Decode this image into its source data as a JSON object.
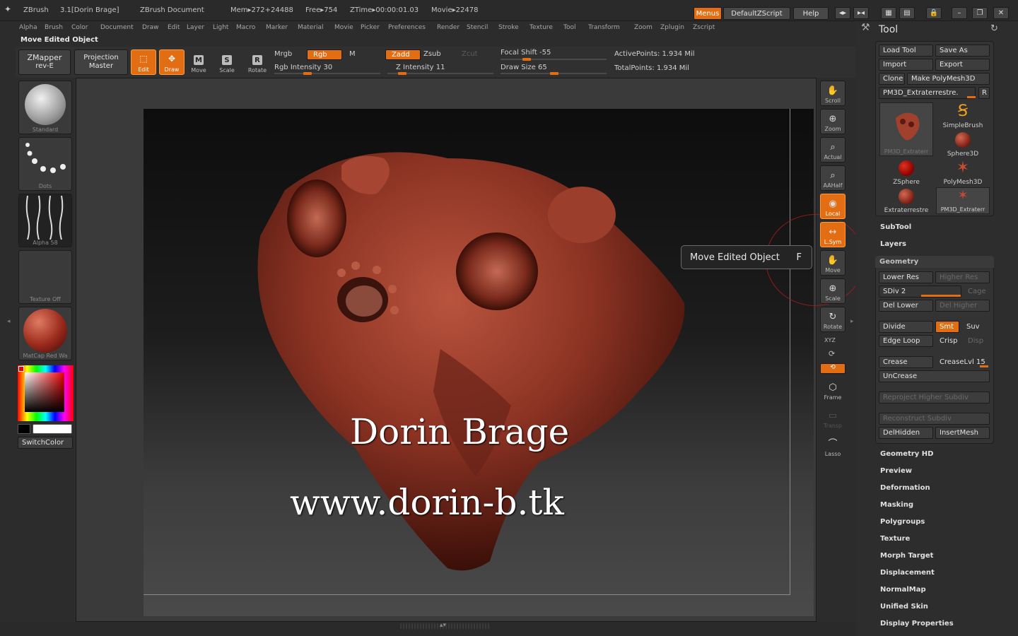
{
  "titlebar": {
    "app": "ZBrush",
    "version": "3.1[Dorin Brage]",
    "document": "ZBrush Document",
    "mem": "Mem▸272+24488",
    "free": "Free▸754",
    "ztime": "ZTime▸00:00:01.03",
    "movie": "Movie▸22478",
    "menus_label": "Menus",
    "script_label": "DefaultZScript",
    "help_label": "Help"
  },
  "menus": [
    "Alpha",
    "Brush",
    "Color",
    "Document",
    "Draw",
    "Edit",
    "Layer",
    "Light",
    "Macro",
    "Marker",
    "Material",
    "Movie",
    "Picker",
    "Preferences",
    "Render",
    "Stencil",
    "Stroke",
    "Texture",
    "Tool",
    "Transform",
    "Zoom",
    "Zplugin",
    "Zscript"
  ],
  "status_message": "Move Edited Object",
  "shelf": {
    "zmapper_line1": "ZMapper",
    "zmapper_line2": "rev-E",
    "projection_line1": "Projection",
    "projection_line2": "Master",
    "tools": [
      {
        "label": "Edit",
        "glyph": "⬚"
      },
      {
        "label": "Draw",
        "glyph": "✥"
      },
      {
        "label": "Move",
        "glyph": "M"
      },
      {
        "label": "Scale",
        "glyph": "S"
      },
      {
        "label": "Rotate",
        "glyph": "R"
      }
    ],
    "mrgb": "Mrgb",
    "rgb": "Rgb",
    "m": "M",
    "rgb_intensity": "Rgb Intensity 30",
    "rgb_intensity_value": 30,
    "zadd": "Zadd",
    "zsub": "Zsub",
    "zcut": "Zcut",
    "z_intensity": "Z Intensity 11",
    "z_intensity_value": 11,
    "focal_shift": "Focal Shift -55",
    "focal_shift_value": -55,
    "draw_size": "Draw Size 65",
    "draw_size_value": 65,
    "active_points": "ActivePoints: 1.934 Mil",
    "total_points": "TotalPoints: 1.934 Mil"
  },
  "left_panel": {
    "brush_caption": "Standard",
    "stroke_caption": "Dots",
    "alpha_caption": "Alpha 58",
    "texture_caption": "Texture Off",
    "material_caption": "MatCap Red Wa",
    "switch_color": "SwitchColor"
  },
  "watermark": {
    "name": "Dorin Brage",
    "url": "www.dorin-b.tk"
  },
  "tooltip": {
    "text": "Move Edited Object",
    "key": "F"
  },
  "right_tools": [
    {
      "label": "Scroll",
      "glyph": "✋",
      "active": false
    },
    {
      "label": "Zoom",
      "glyph": "⊕",
      "active": false
    },
    {
      "label": "Actual",
      "glyph": "⌕",
      "active": false
    },
    {
      "label": "AAHalf",
      "glyph": "⌕",
      "active": false
    },
    {
      "label": "Local",
      "glyph": "◉",
      "active": true
    },
    {
      "label": "L.Sym",
      "glyph": "↔",
      "active": true
    },
    {
      "label": "Move",
      "glyph": "✋",
      "active": false
    },
    {
      "label": "Scale",
      "glyph": "⊕",
      "active": false
    },
    {
      "label": "Rotate",
      "glyph": "↻",
      "active": false
    }
  ],
  "right_tools_extra": {
    "xyz": "XYZ",
    "frame": "Frame",
    "transp": "Transp",
    "lasso": "Lasso"
  },
  "tool_panel": {
    "title": "Tool",
    "load_tool": "Load Tool",
    "save_as": "Save As",
    "import": "Import",
    "export": "Export",
    "clone": "Clone",
    "make_polymesh": "Make PolyMesh3D",
    "current_tool": "PM3D_Extraterrestre.",
    "r_label": "R",
    "thumbnails": [
      {
        "label": "PM3D_Extraterr"
      },
      {
        "label": "SimpleBrush"
      },
      {
        "label": "Sphere3D"
      },
      {
        "label": "ZSphere"
      },
      {
        "label": "PolyMesh3D"
      },
      {
        "label": "Extraterrestre"
      },
      {
        "label": "PM3D_Extraterr"
      }
    ],
    "subtool": "SubTool",
    "layers": "Layers",
    "geometry": "Geometry",
    "lower_res": "Lower Res",
    "higher_res": "Higher Res",
    "sdiv": "SDiv 2",
    "sdiv_value": 2,
    "cage": "Cage",
    "del_lower": "Del Lower",
    "del_higher": "Del Higher",
    "divide": "Divide",
    "smt": "Smt",
    "suv": "Suv",
    "edge_loop": "Edge Loop",
    "crisp": "Crisp",
    "disp": "Disp",
    "crease": "Crease",
    "crease_lvl": "CreaseLvl 15",
    "crease_lvl_value": 15,
    "uncrease": "UnCrease",
    "reproject": "Reproject Higher Subdiv",
    "reconstruct": "Reconstruct Subdiv",
    "delhidden": "DelHidden",
    "insertmesh": "InsertMesh",
    "sections": [
      "Geometry HD",
      "Preview",
      "Deformation",
      "Masking",
      "Polygroups",
      "Texture",
      "Morph Target",
      "Displacement",
      "NormalMap",
      "Unified Skin",
      "Display Properties"
    ]
  },
  "colors": {
    "accent": "#e26d12",
    "clay": "#9a3a2a"
  }
}
